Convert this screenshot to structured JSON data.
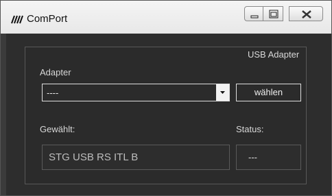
{
  "window": {
    "title": "ComPort",
    "icon": "comport-app-icon"
  },
  "controls": {
    "minimize_icon": "minimize-icon",
    "maximize_icon": "maximize-icon",
    "close_icon": "close-icon"
  },
  "panel": {
    "heading": "USB Adapter",
    "adapter_label": "Adapter",
    "adapter_selected": "----",
    "choose_button": "wählen",
    "selected_label": "Gewählt:",
    "selected_value": "STG USB RS ITL B",
    "status_label": "Status:",
    "status_value": "---"
  },
  "colors": {
    "background": "#2d2d2d",
    "panel_border": "#595959",
    "control_border": "#e0e0e0",
    "text": "#d8d8d8"
  }
}
